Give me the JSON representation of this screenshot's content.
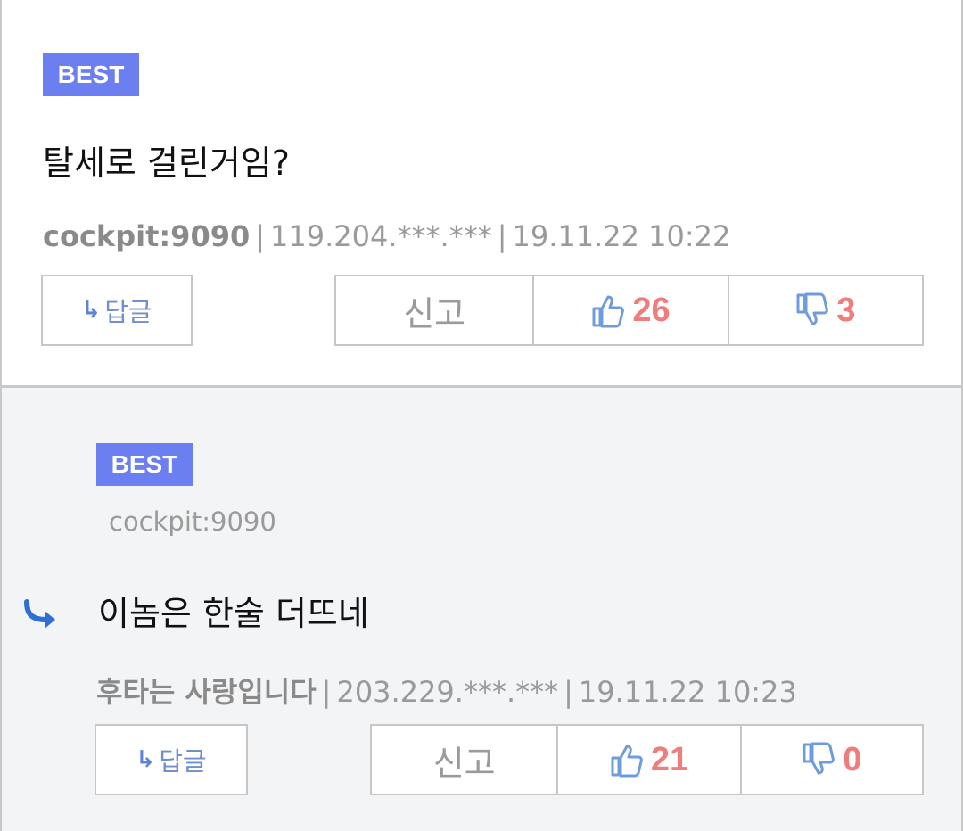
{
  "comments": [
    {
      "badge": "BEST",
      "text": "탈세로 걸린거임?",
      "author": "cockpit:9090",
      "ip": "119.204.***.***",
      "date": "19.11.22 10:22",
      "reply_label": "답글",
      "report_label": "신고",
      "likes": "26",
      "dislikes": "3"
    },
    {
      "badge": "BEST",
      "quoted_author": "cockpit:9090",
      "text": "이놈은 한술 더뜨네",
      "author": "후타는 사랑입니다",
      "ip": "203.229.***.***",
      "date": "19.11.22 10:23",
      "reply_label": "답글",
      "report_label": "신고",
      "likes": "21",
      "dislikes": "0"
    }
  ],
  "colors": {
    "badge": "#6b7ff0",
    "count": "#ef7d7d",
    "thumb": "#6f9cdc",
    "reply_arrow": "#2f6fd1"
  },
  "icons": [
    "reply-arrow-icon",
    "thumbs-up-icon",
    "thumbs-down-icon"
  ]
}
